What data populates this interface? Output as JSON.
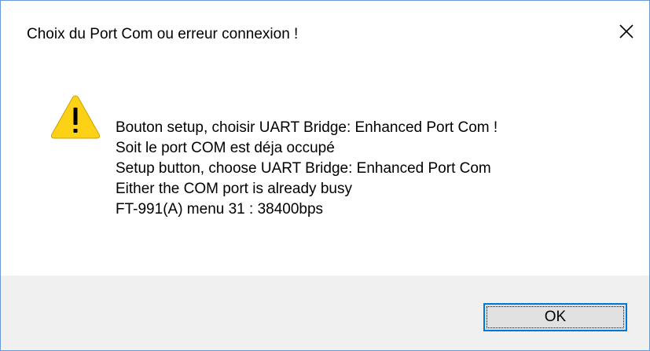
{
  "dialog": {
    "title": "Choix du Port Com ou erreur connexion !",
    "close_icon": "close-icon",
    "icon": "warning-icon",
    "message_lines": [
      "Bouton setup, choisir UART Bridge: Enhanced Port Com !",
      "Soit le port COM est déja occupé",
      "Setup button, choose UART Bridge: Enhanced Port Com",
      "Either the COM port is already busy",
      "FT-991(A) menu 31 : 38400bps"
    ],
    "ok_label": "OK"
  },
  "colors": {
    "border": "#6a9ad4",
    "footer_bg": "#f0f0f0",
    "button_bg": "#e1e1e1",
    "button_focus_border": "#0078d7",
    "warning_yellow": "#fcd116"
  }
}
